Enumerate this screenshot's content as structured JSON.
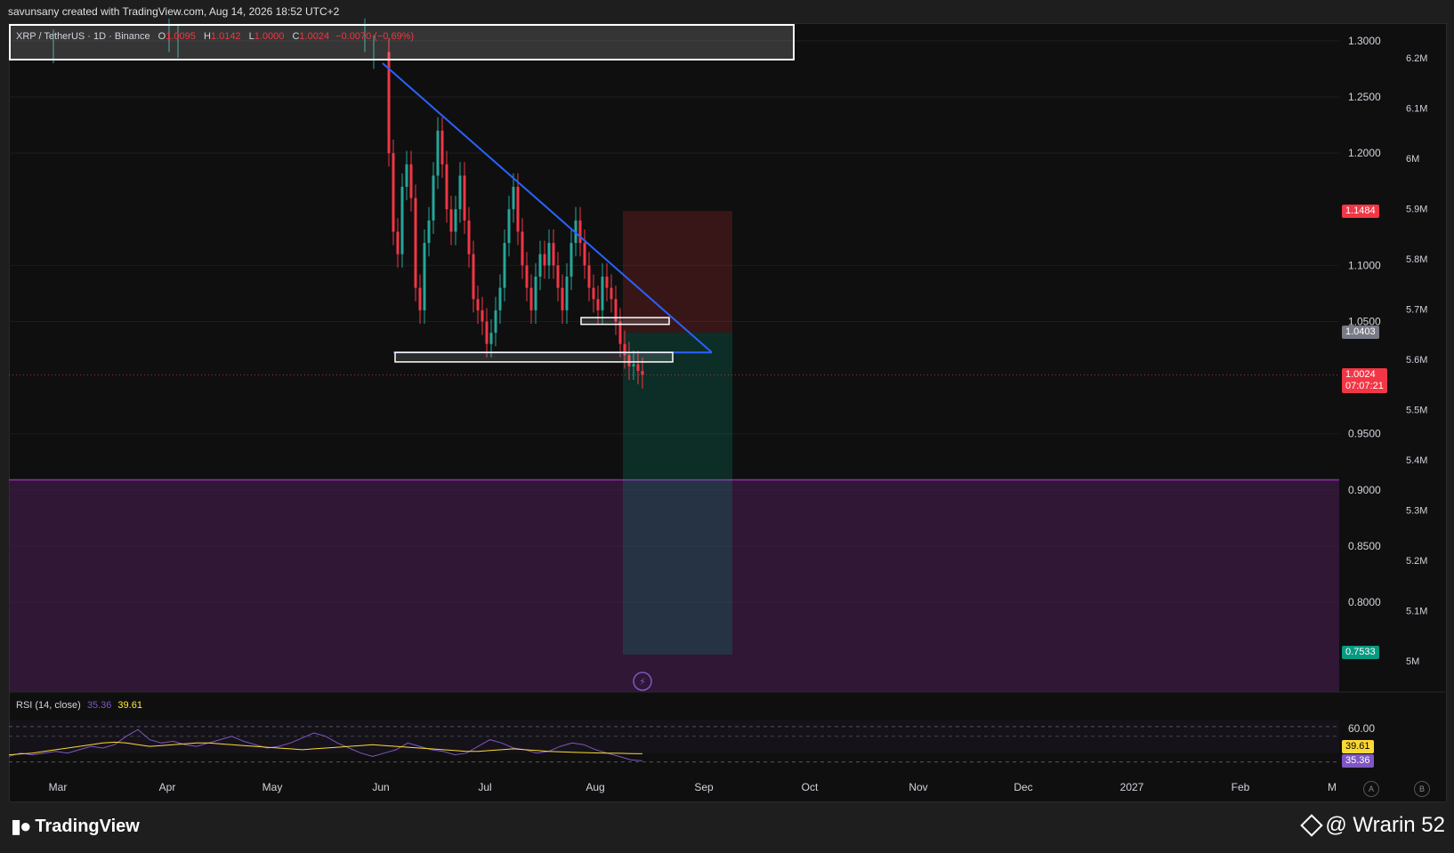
{
  "header": {
    "created_by": "savunsany created with TradingView.com, Aug 14, 2026 18:52 UTC+2"
  },
  "legend": {
    "symbol": "XRP / TetherUS · 1D · Binance",
    "o_label": "O",
    "o_value": "1.0095",
    "h_label": "H",
    "h_value": "1.0142",
    "l_label": "L",
    "l_value": "1.0000",
    "c_label": "C",
    "c_value": "1.0024",
    "change": "−0.0070 (−0.69%)"
  },
  "rsi_legend": {
    "label": "RSI (14, close)",
    "value1": "35.36",
    "value2": "39.61"
  },
  "price_tags": {
    "target": "1.1484",
    "entry": "1.0403",
    "last": "1.0024",
    "countdown": "07:07:21",
    "stop": "0.7533",
    "rsi_ma": "39.61",
    "rsi": "35.36"
  },
  "colors": {
    "up": "#26a69a",
    "down": "#f23645",
    "trendline": "#2962ff",
    "zone": "#4a1f56",
    "zone_line": "#9c27b0",
    "rsi_line": "#7e57c2",
    "rsi_ma": "#fdd835"
  },
  "footer": {
    "brand": "TradingView",
    "watermark": "@ Wrarin 52"
  },
  "axis_buttons": {
    "auto": "A",
    "b": "B"
  },
  "chart_data": {
    "type": "candlestick",
    "title": "XRP / TetherUS · 1D · Binance",
    "price_axis": {
      "min": 0.72,
      "max": 1.315,
      "ticks": [
        "1.3000",
        "1.2500",
        "1.2000",
        "1.1000",
        "1.0500",
        "0.9500",
        "0.9000",
        "0.8500",
        "0.8000"
      ],
      "tick_values": [
        1.3,
        1.25,
        1.2,
        1.1,
        1.05,
        0.95,
        0.9,
        0.85,
        0.8
      ]
    },
    "volume_axis": {
      "ticks": [
        "6.2M",
        "6.1M",
        "6M",
        "5.9M",
        "5.8M",
        "5.7M",
        "5.6M",
        "5.5M",
        "5.4M",
        "5.3M",
        "5.2M",
        "5.1M",
        "5M"
      ]
    },
    "time_axis": {
      "labels": [
        "Mar",
        "Apr",
        "May",
        "Jun",
        "Jul",
        "Aug",
        "Sep",
        "Oct",
        "Nov",
        "Dec",
        "2027",
        "Feb",
        "M"
      ]
    },
    "candles_close_path": [
      1.29,
      1.2,
      1.13,
      1.11,
      1.17,
      1.19,
      1.16,
      1.08,
      1.06,
      1.12,
      1.14,
      1.18,
      1.22,
      1.19,
      1.15,
      1.13,
      1.15,
      1.18,
      1.14,
      1.11,
      1.07,
      1.06,
      1.05,
      1.03,
      1.04,
      1.06,
      1.08,
      1.12,
      1.15,
      1.17,
      1.13,
      1.1,
      1.08,
      1.06,
      1.09,
      1.11,
      1.1,
      1.12,
      1.1,
      1.08,
      1.06,
      1.09,
      1.12,
      1.14,
      1.12,
      1.1,
      1.08,
      1.07,
      1.06,
      1.09,
      1.08,
      1.07,
      1.05,
      1.03,
      1.02,
      1.01,
      1.012,
      1.006,
      1.0024
    ],
    "trendline_upper": {
      "from_price": 1.28,
      "to_price": 1.0225
    },
    "trendline_lower": {
      "price": 1.0225
    },
    "support_boxes": [
      {
        "top": 1.0225,
        "bottom": 1.014
      },
      {
        "top": 1.0535,
        "bottom": 1.0475
      }
    ],
    "position": {
      "target": 1.1484,
      "entry": 1.0403,
      "stop": 0.7533
    },
    "zone": {
      "top": 0.909,
      "bottom": 0.72
    },
    "rsi": {
      "overbought": 60,
      "oversold": 40,
      "values": [
        38,
        40,
        39,
        40,
        41,
        40,
        42,
        44,
        43,
        45,
        50,
        54,
        48,
        46,
        47,
        45,
        44,
        46,
        48,
        50,
        47,
        45,
        43,
        44,
        46,
        49,
        52,
        50,
        46,
        43,
        40,
        38,
        40,
        42,
        46,
        44,
        42,
        41,
        39,
        40,
        44,
        48,
        46,
        43,
        42,
        40,
        41,
        44,
        46,
        45,
        42,
        40,
        38,
        36,
        35.36
      ],
      "ma": [
        39,
        39.5,
        40,
        41,
        42,
        43,
        44,
        45,
        46,
        46.5,
        46,
        45,
        44,
        44.5,
        45,
        45.5,
        46,
        46,
        45.5,
        45,
        44.5,
        44,
        43.5,
        43,
        42.5,
        42,
        42.5,
        43,
        43.5,
        44,
        44.5,
        45,
        44.5,
        44,
        43.5,
        43,
        42.5,
        42,
        41.5,
        41,
        41,
        41.5,
        42,
        42.5,
        42,
        41.5,
        41,
        40.8,
        40.5,
        40.3,
        40.1,
        40,
        39.9,
        39.7,
        39.61
      ]
    }
  }
}
